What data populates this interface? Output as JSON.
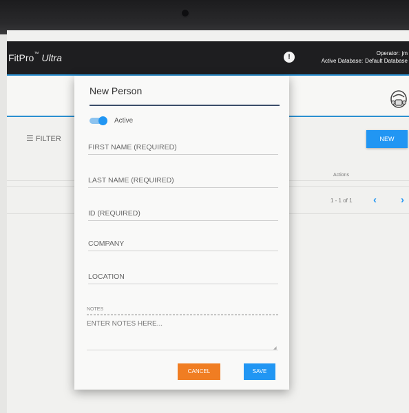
{
  "app": {
    "brand": "FitPro",
    "brand_tm": "™",
    "brand_suffix": "Ultra",
    "operator_label": "Operator:",
    "operator_value": "jm",
    "database_label": "Active Database:",
    "database_value": "Default Database"
  },
  "toolbar": {
    "filter_label": "FILTER",
    "new_label": "NEW"
  },
  "table": {
    "actions_header": "Actions",
    "pagination": "1 - 1 of 1",
    "prev_icon": "‹",
    "next_icon": "›"
  },
  "dialog": {
    "title": "New Person",
    "active_label": "Active",
    "active_on": true,
    "fields": {
      "first_name": "FIRST NAME (REQUIRED)",
      "last_name": "LAST NAME (REQUIRED)",
      "id": "ID (REQUIRED)",
      "company": "COMPANY",
      "location": "LOCATION"
    },
    "notes_label": "NOTES",
    "notes_placeholder": "ENTER NOTES HERE...",
    "cancel_label": "CANCEL",
    "save_label": "SAVE"
  },
  "colors": {
    "accent": "#2196f3",
    "cancel": "#f07d22",
    "topbar": "#1e1e20"
  },
  "icons": {
    "info": "info-icon",
    "respirator": "respirator-icon",
    "filter": "filter-icon"
  }
}
